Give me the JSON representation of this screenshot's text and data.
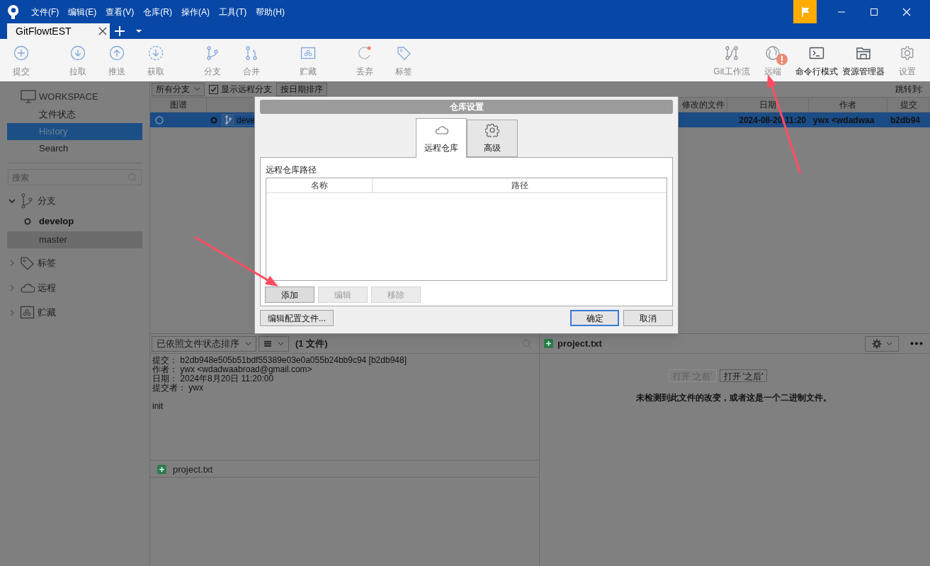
{
  "menu": [
    "文件(F)",
    "编辑(E)",
    "查看(V)",
    "仓库(R)",
    "操作(A)",
    "工具(T)",
    "帮助(H)"
  ],
  "tabs": [
    {
      "label": "GitFlowtEST",
      "selected": true
    }
  ],
  "toolbar": {
    "left": [
      {
        "label": "提交",
        "disabled": true
      },
      {
        "label": "拉取",
        "disabled": true
      },
      {
        "label": "推送",
        "disabled": true
      },
      {
        "label": "获取",
        "disabled": true
      },
      {
        "label": "分支",
        "disabled": true
      },
      {
        "label": "合并",
        "disabled": true
      },
      {
        "label": "贮藏",
        "disabled": true
      },
      {
        "label": "丢弃",
        "disabled": true
      },
      {
        "label": "标签",
        "disabled": true
      }
    ],
    "right": [
      {
        "label": "Git工作流",
        "disabled": true,
        "alert": false
      },
      {
        "label": "远端",
        "disabled": true,
        "alert": true
      },
      {
        "label": "命令行模式",
        "disabled": false,
        "alert": false
      },
      {
        "label": "资源管理器",
        "disabled": false,
        "alert": false
      },
      {
        "label": "设置",
        "disabled": true,
        "alert": false
      }
    ]
  },
  "sidebar": {
    "workspace": "WORKSPACE",
    "items": [
      {
        "label": "文件状态",
        "selected": false
      },
      {
        "label": "History",
        "selected": true
      },
      {
        "label": "Search",
        "selected": false
      }
    ],
    "search": {
      "placeholder": "搜索"
    },
    "sections": [
      {
        "label": "分支",
        "expanded": true,
        "children": [
          {
            "label": "develop",
            "current": true,
            "selected": false
          },
          {
            "label": "master",
            "current": false,
            "selected": true
          }
        ]
      },
      {
        "label": "标签",
        "expanded": false
      },
      {
        "label": "远程",
        "expanded": false
      },
      {
        "label": "贮藏",
        "expanded": false
      }
    ]
  },
  "history": {
    "filters": {
      "branch": "所有分支",
      "show_remote": {
        "label": "显示远程分支",
        "checked": true
      },
      "order": "按日期排序",
      "jump": "跳转到:"
    },
    "columns": [
      "图谱",
      "修改的文件",
      "日期",
      "作者",
      "提交"
    ],
    "rows": [
      {
        "selected": true,
        "branch": "deve",
        "date": "2024-08-20 11:20",
        "author": "ywx <wdadwaa",
        "commit": "b2db94"
      }
    ]
  },
  "details": {
    "sort": "已依照文件状态排序",
    "count": "(1 文件)",
    "lines": [
      "提交： b2db948e505b51bdf55389e03e0a055b24bb9c94 [b2db948]",
      "作者： ywx <wdadwaabroad@gmail.com>",
      "日期： 2024年8月20日 11:20:00",
      "提交者： ywx"
    ],
    "message": "init",
    "files": [
      {
        "name": "project.txt",
        "added": true
      }
    ]
  },
  "diff": {
    "file": {
      "name": "project.txt",
      "added": true
    },
    "buttons": [
      {
        "label": "打开 '之前'",
        "disabled": true
      },
      {
        "label": "打开 '之后'",
        "disabled": false
      }
    ],
    "message": "未检测到此文件的改变，或者这是一个二进制文件。"
  },
  "dialog": {
    "title": "仓库设置",
    "tabs": [
      {
        "label": "远程仓库",
        "selected": true
      },
      {
        "label": "高级",
        "selected": false
      }
    ],
    "group": "远程仓库路径",
    "columns": [
      "名称",
      "路径"
    ],
    "actions": [
      {
        "label": "添加",
        "disabled": false
      },
      {
        "label": "编辑",
        "disabled": true
      },
      {
        "label": "移除",
        "disabled": true
      }
    ],
    "edit_config": "编辑配置文件...",
    "ok": "确定",
    "cancel": "取消"
  }
}
